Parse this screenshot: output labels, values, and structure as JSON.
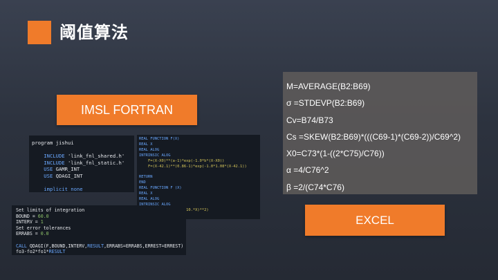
{
  "page": {
    "title": "阈值算法"
  },
  "buttons": {
    "imsl": "IMSL FORTRAN",
    "excel": "EXCEL"
  },
  "code_program": [
    [
      {
        "t": "program jishui",
        "c": "white"
      }
    ],
    [
      {
        "t": "",
        "c": "white"
      }
    ],
    [
      {
        "t": "    INCLUDE ",
        "c": "blue"
      },
      {
        "t": "'link_fnl_shared.h'",
        "c": "white"
      }
    ],
    [
      {
        "t": "    INCLUDE ",
        "c": "blue"
      },
      {
        "t": "'link_fnl_static.h'",
        "c": "white"
      }
    ],
    [
      {
        "t": "    USE ",
        "c": "blue"
      },
      {
        "t": "GAMR_INT",
        "c": "white"
      }
    ],
    [
      {
        "t": "    USE ",
        "c": "blue"
      },
      {
        "t": "QDAGI_INT",
        "c": "white"
      }
    ],
    [
      {
        "t": "",
        "c": "white"
      }
    ],
    [
      {
        "t": "    implicit none",
        "c": "blue"
      }
    ]
  ],
  "code_function": [
    [
      {
        "t": "REAL FUNCTION F(X)",
        "c": "blue"
      }
    ],
    [
      {
        "t": "REAL X",
        "c": "blue"
      }
    ],
    [
      {
        "t": "REAL ALOG",
        "c": "blue"
      }
    ],
    [
      {
        "t": "INTRINSIC ALOG",
        "c": "blue"
      }
    ],
    [
      {
        "t": "    F=(X-X0)**(a-1)*exp(-1.0*b*(X-X0))",
        "c": "yellow"
      }
    ],
    [
      {
        "t": "    F=(X-42.1)**(0.86-1)*exp(-1.0*1.08*(X-42.1))",
        "c": "yellow"
      }
    ],
    [
      {
        "t": "",
        "c": "white"
      }
    ],
    [
      {
        "t": "RETURN",
        "c": "blue"
      }
    ],
    [
      {
        "t": "END",
        "c": "blue"
      }
    ],
    [
      {
        "t": "REAL FUNCTION F (X)",
        "c": "blue"
      }
    ],
    [
      {
        "t": "REAL X",
        "c": "blue"
      }
    ],
    [
      {
        "t": "REAL ALOG",
        "c": "blue"
      }
    ],
    [
      {
        "t": "INTRINSIC ALOG",
        "c": "blue"
      }
    ],
    [
      {
        "t": "    F = ALOG(X)/(1.+(10.*X)**2)",
        "c": "yellow"
      }
    ],
    [
      {
        "t": "RETURN",
        "c": "blue"
      }
    ],
    [
      {
        "t": "END",
        "c": "blue"
      }
    ]
  ],
  "code_integration": [
    [
      {
        "t": "Set limits of integration",
        "c": "white"
      }
    ],
    [
      {
        "t": "BOUND = ",
        "c": "white"
      },
      {
        "t": "60.0",
        "c": "green"
      }
    ],
    [
      {
        "t": "INTERV = ",
        "c": "white"
      },
      {
        "t": "1",
        "c": "green"
      }
    ],
    [
      {
        "t": "Set error tolerances",
        "c": "white"
      }
    ],
    [
      {
        "t": "ERRABS = ",
        "c": "white"
      },
      {
        "t": "0.0",
        "c": "green"
      }
    ],
    [
      {
        "t": "",
        "c": "white"
      }
    ],
    [
      {
        "t": "CALL ",
        "c": "blue"
      },
      {
        "t": "QDAGI(F,BOUND,INTERV,",
        "c": "white"
      },
      {
        "t": "RESULT",
        "c": "blue"
      },
      {
        "t": ",ERRABS=ERRABS,ERREST=ERREST)",
        "c": "white"
      }
    ],
    [
      {
        "t": "fo3-fo2*fo1*",
        "c": "white"
      },
      {
        "t": "RESULT",
        "c": "blue"
      }
    ]
  ],
  "excel_formulas": [
    "M=AVERAGE(B2:B69)",
    "σ =STDEVP(B2:B69)",
    "Cv=B74/B73",
    "Cs =SKEW(B2:B69)*(((C69-1)*(C69-2))/C69^2)",
    "X0=C73*(1-((2*C75)/C76))",
    "α =4/C76^2",
    "β =2/(C74*C76)"
  ],
  "colors": {
    "accent": "#f07b2a",
    "white": "#e6e8ec",
    "blue": "#6aa8ff",
    "red": "#e0635a",
    "yellow": "#d8c85a",
    "green": "#8fc46a"
  }
}
